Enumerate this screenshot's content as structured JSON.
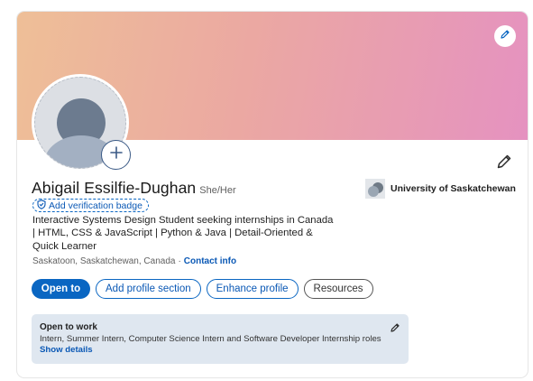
{
  "profile": {
    "name": "Abigail Essilfie-Dughan",
    "pronouns": "She/Her",
    "verification_badge_label": "Add verification badge",
    "headline": "Interactive Systems Design Student seeking internships in Canada | HTML, CSS & JavaScript | Python & Java | Detail-Oriented & Quick Learner",
    "location": "Saskatoon, Saskatchewan, Canada",
    "separator": "·",
    "contact_info_label": "Contact info",
    "education": "University of Saskatchewan"
  },
  "actions": {
    "open_to": "Open to",
    "add_section": "Add profile section",
    "enhance": "Enhance profile",
    "resources": "Resources"
  },
  "open_to_work": {
    "title": "Open to work",
    "roles": "Intern, Summer Intern, Computer Science Intern and Software Developer Internship roles",
    "show_details": "Show details"
  },
  "icons": {
    "cover_edit": "pencil-icon",
    "intro_edit": "pencil-icon",
    "avatar_add": "plus-icon",
    "verify": "shield-check-icon",
    "open_to_work_edit": "pencil-icon"
  },
  "colors": {
    "brand_blue": "#0a66c2",
    "cover_gradient_start": "#eebf97",
    "cover_gradient_end": "#e592c0",
    "open_to_work_bg": "#dfe7f0"
  }
}
